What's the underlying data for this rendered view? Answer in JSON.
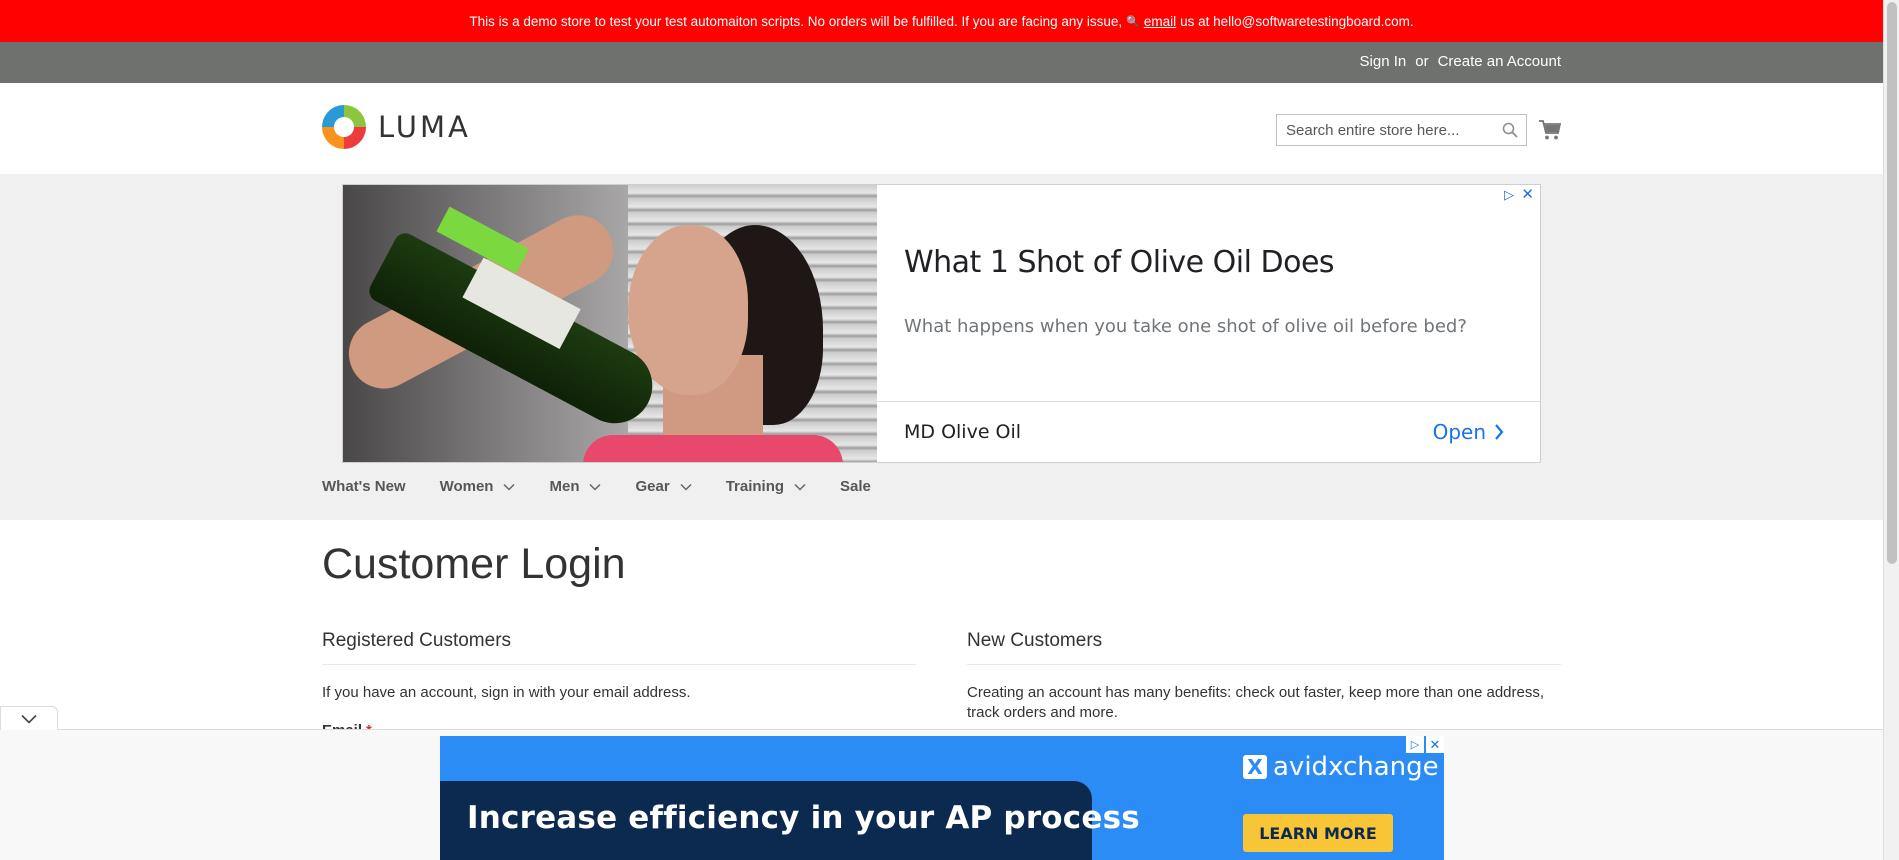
{
  "demo_banner": {
    "text_before": "This is a demo store to test your test automaiton scripts. No orders will be fulfilled. If you are facing any issue,",
    "glyph": "🔍",
    "link": "email",
    "text_after": "us at hello@softwaretestingboard.com."
  },
  "header": {
    "sign_in": "Sign In",
    "or": "or",
    "create_account": "Create an Account",
    "logo_text": "LUMA",
    "search_placeholder": "Search entire store here..."
  },
  "ad": {
    "headline": "What 1 Shot of Olive Oil Does",
    "body": "What happens when you take one shot of olive oil before bed?",
    "advertiser": "MD Olive Oil",
    "cta": "Open",
    "adchoices_glyph": "▷",
    "close_glyph": "✕"
  },
  "nav": {
    "items": [
      {
        "label": "What's New",
        "has_dropdown": false
      },
      {
        "label": "Women",
        "has_dropdown": true
      },
      {
        "label": "Men",
        "has_dropdown": true
      },
      {
        "label": "Gear",
        "has_dropdown": true
      },
      {
        "label": "Training",
        "has_dropdown": true
      },
      {
        "label": "Sale",
        "has_dropdown": false
      }
    ]
  },
  "main": {
    "page_title": "Customer Login",
    "registered": {
      "title": "Registered Customers",
      "text": "If you have an account, sign in with your email address.",
      "email_label": "Email",
      "required_mark": "*"
    },
    "new_customers": {
      "title": "New Customers",
      "text": "Creating an account has many benefits: check out faster, keep more than one address, track orders and more."
    }
  },
  "bottom_ad": {
    "headline": "Increase efficiency in your AP process",
    "brand": "avidxchange",
    "brand_mark": "X",
    "cta": "LEARN MORE",
    "adchoices_glyph": "▷",
    "close_glyph": "✕"
  },
  "colors": {
    "banner_red": "#ff0101",
    "header_gray": "#6e716e",
    "nav_band": "#f0f0f0",
    "ad_link_blue": "#1a73e8",
    "bottom_ad_blue": "#2b8cf5",
    "bottom_ad_navy": "#0c2a50",
    "cta_yellow": "#f8c537"
  }
}
